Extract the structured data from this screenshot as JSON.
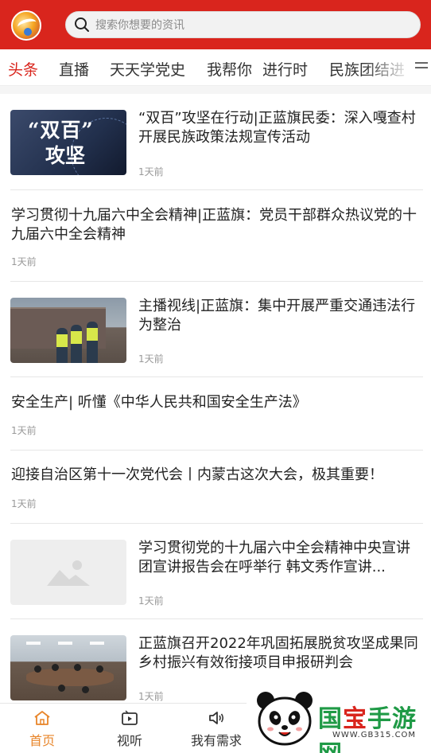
{
  "header": {
    "search_placeholder": "搜索你想要的资讯"
  },
  "tabs": [
    {
      "label": "头条",
      "active": true
    },
    {
      "label": "直播"
    },
    {
      "label": "天天学党史"
    },
    {
      "label": "我帮你"
    },
    {
      "label": "进行时"
    },
    {
      "label": "民族团结进"
    }
  ],
  "news": [
    {
      "title": "“双百”攻坚在行动|正蓝旗民委：深入嘎查村开展民族政策法规宣传活动",
      "time": "1天前",
      "thumb_text_1": "“双百”",
      "thumb_text_2": "攻坚"
    },
    {
      "title": "学习贯彻十九届六中全会精神|正蓝旗：党员干部群众热议党的十九届六中全会精神",
      "time": "1天前"
    },
    {
      "title": "主播视线|正蓝旗：集中开展严重交通违法行为整治",
      "time": "1天前"
    },
    {
      "title": "安全生产|   听懂《中华人民共和国安全生产法》",
      "time": "1天前"
    },
    {
      "title": "迎接自治区第十一次党代会丨内蒙古这次大会，极其重要！",
      "time": "1天前"
    },
    {
      "title": "学习贯彻党的十九届六中全会精神中央宣讲团宣讲报告会在呼举行  韩文秀作宣讲...",
      "time": "1天前"
    },
    {
      "title": "正蓝旗召开2022年巩固拓展脱贫攻坚成果同乡村振兴有效衔接项目申报研判会",
      "time": "1天前"
    }
  ],
  "bottom_nav": [
    {
      "label": "首页",
      "icon": "home-icon",
      "active": true
    },
    {
      "label": "视听",
      "icon": "video-icon"
    },
    {
      "label": "我有需求",
      "icon": "speaker-icon"
    }
  ],
  "watermark": {
    "text_green_1": "国",
    "text_red": "宝",
    "text_green_2": "手游网",
    "url": "WWW.GB315.COM"
  },
  "colors": {
    "brand_red": "#d9251d",
    "active_orange": "#e8852a",
    "watermark_green": "#1f9a46"
  }
}
